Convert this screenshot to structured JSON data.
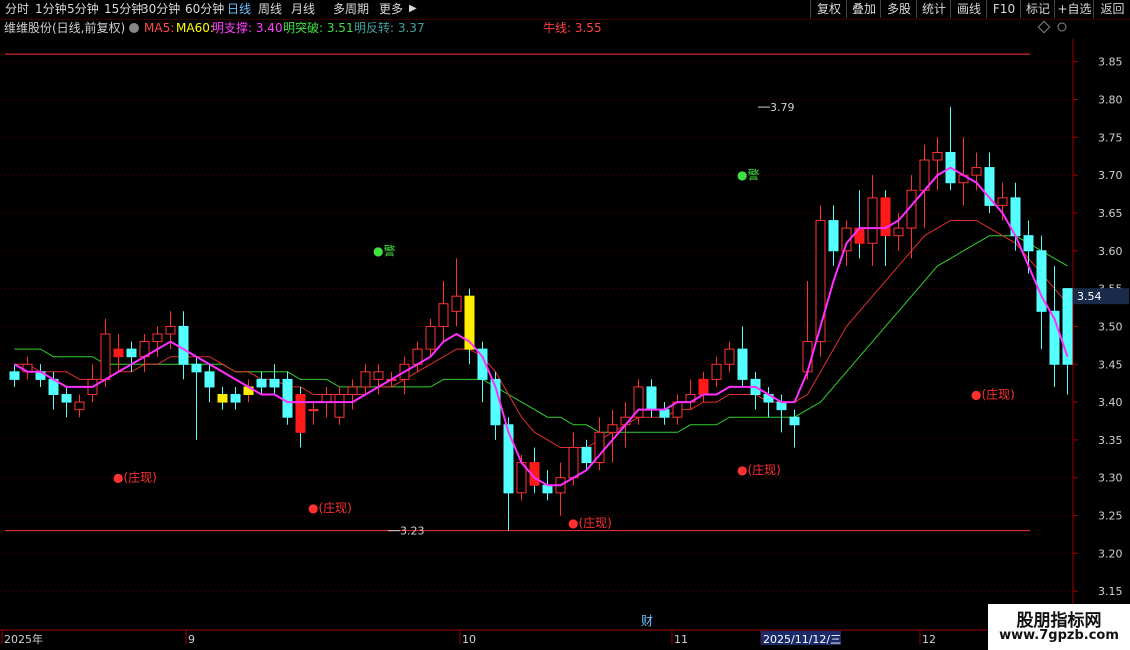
{
  "toolbar": {
    "periods": [
      "分时",
      "1分钟",
      "5分钟",
      "15分钟",
      "30分钟",
      "60分钟",
      "日线",
      "周线",
      "月线",
      "多周期",
      "更多"
    ],
    "active": "日线",
    "right": [
      "复权",
      "叠加",
      "多股",
      "统计",
      "画线",
      "F10",
      "标记",
      "+自选",
      "返回"
    ]
  },
  "indicator_bar": {
    "stock": "维维股份(日线,前复权)",
    "items": [
      {
        "text": "MA5:",
        "color": "#ff4a4a"
      },
      {
        "text": "MA60:",
        "color": "#ffff00"
      },
      {
        "text": "明支撑: 3.40",
        "color": "#ff40ff"
      },
      {
        "text": "明突破: 3.51",
        "color": "#40e040"
      },
      {
        "text": "明反转: 3.37",
        "color": "#40a0a0"
      }
    ],
    "niu_label": "牛线: 3.55"
  },
  "current_price": "3.54",
  "x_axis": {
    "labels": [
      "2025年",
      "9",
      "10",
      "11",
      "2025/11/12/三",
      "12"
    ],
    "cai": "财"
  },
  "watermark": {
    "line1": "股朋指标网",
    "line2": "www.7gpzb.com"
  },
  "colors": {
    "up": "#ff3232",
    "down": "#54ffff",
    "ma_fast": "#ff30ff",
    "ma_mid": "#e03030",
    "ma_slow": "#30d030",
    "grid": "#5a0000"
  },
  "chart_data": {
    "type": "candlestick",
    "y_ticks": [
      "3.85",
      "3.80",
      "3.75",
      "3.70",
      "3.65",
      "3.60",
      "3.55",
      "3.50",
      "3.45",
      "3.40",
      "3.35",
      "3.30",
      "3.25",
      "3.20",
      "3.15"
    ],
    "ylim": [
      3.1,
      3.88
    ],
    "n_bars": 82,
    "ohlc": [
      [
        3.44,
        3.45,
        3.42,
        3.43
      ],
      [
        3.44,
        3.46,
        3.43,
        3.45
      ],
      [
        3.44,
        3.45,
        3.42,
        3.43
      ],
      [
        3.43,
        3.44,
        3.39,
        3.41
      ],
      [
        3.41,
        3.42,
        3.38,
        3.4
      ],
      [
        3.39,
        3.41,
        3.38,
        3.4
      ],
      [
        3.41,
        3.45,
        3.4,
        3.43
      ],
      [
        3.43,
        3.51,
        3.42,
        3.49
      ],
      [
        3.46,
        3.49,
        3.44,
        3.47
      ],
      [
        3.47,
        3.48,
        3.44,
        3.46
      ],
      [
        3.46,
        3.49,
        3.44,
        3.48
      ],
      [
        3.48,
        3.5,
        3.46,
        3.49
      ],
      [
        3.49,
        3.52,
        3.47,
        3.5
      ],
      [
        3.5,
        3.52,
        3.43,
        3.45
      ],
      [
        3.45,
        3.46,
        3.35,
        3.44
      ],
      [
        3.44,
        3.45,
        3.4,
        3.42
      ],
      [
        3.41,
        3.42,
        3.39,
        3.4
      ],
      [
        3.41,
        3.42,
        3.39,
        3.4
      ],
      [
        3.41,
        3.43,
        3.4,
        3.42
      ],
      [
        3.43,
        3.44,
        3.41,
        3.42
      ],
      [
        3.43,
        3.45,
        3.41,
        3.42
      ],
      [
        3.43,
        3.44,
        3.37,
        3.38
      ],
      [
        3.41,
        3.42,
        3.34,
        3.36
      ],
      [
        3.39,
        3.4,
        3.37,
        3.39
      ],
      [
        3.4,
        3.42,
        3.38,
        3.41
      ],
      [
        3.38,
        3.42,
        3.37,
        3.41
      ],
      [
        3.41,
        3.43,
        3.39,
        3.42
      ],
      [
        3.42,
        3.45,
        3.41,
        3.44
      ],
      [
        3.43,
        3.45,
        3.41,
        3.44
      ],
      [
        3.43,
        3.44,
        3.42,
        3.43
      ],
      [
        3.43,
        3.46,
        3.41,
        3.45
      ],
      [
        3.45,
        3.48,
        3.44,
        3.47
      ],
      [
        3.47,
        3.51,
        3.46,
        3.5
      ],
      [
        3.5,
        3.56,
        3.48,
        3.53
      ],
      [
        3.52,
        3.59,
        3.5,
        3.54
      ],
      [
        3.54,
        3.55,
        3.45,
        3.47
      ],
      [
        3.47,
        3.48,
        3.4,
        3.43
      ],
      [
        3.43,
        3.44,
        3.35,
        3.37
      ],
      [
        3.37,
        3.38,
        3.23,
        3.28
      ],
      [
        3.28,
        3.33,
        3.27,
        3.32
      ],
      [
        3.32,
        3.34,
        3.28,
        3.29
      ],
      [
        3.29,
        3.31,
        3.27,
        3.28
      ],
      [
        3.28,
        3.32,
        3.25,
        3.3
      ],
      [
        3.3,
        3.36,
        3.29,
        3.34
      ],
      [
        3.34,
        3.35,
        3.31,
        3.32
      ],
      [
        3.32,
        3.38,
        3.31,
        3.36
      ],
      [
        3.36,
        3.39,
        3.32,
        3.37
      ],
      [
        3.37,
        3.4,
        3.34,
        3.38
      ],
      [
        3.38,
        3.43,
        3.37,
        3.42
      ],
      [
        3.42,
        3.43,
        3.38,
        3.39
      ],
      [
        3.39,
        3.4,
        3.37,
        3.38
      ],
      [
        3.38,
        3.41,
        3.37,
        3.4
      ],
      [
        3.4,
        3.43,
        3.39,
        3.41
      ],
      [
        3.41,
        3.44,
        3.4,
        3.43
      ],
      [
        3.43,
        3.46,
        3.42,
        3.45
      ],
      [
        3.45,
        3.48,
        3.44,
        3.47
      ],
      [
        3.47,
        3.5,
        3.42,
        3.43
      ],
      [
        3.43,
        3.44,
        3.39,
        3.41
      ],
      [
        3.41,
        3.42,
        3.38,
        3.4
      ],
      [
        3.4,
        3.41,
        3.36,
        3.39
      ],
      [
        3.38,
        3.39,
        3.34,
        3.37
      ],
      [
        3.44,
        3.56,
        3.43,
        3.48
      ],
      [
        3.48,
        3.66,
        3.46,
        3.64
      ],
      [
        3.64,
        3.66,
        3.58,
        3.6
      ],
      [
        3.6,
        3.64,
        3.58,
        3.63
      ],
      [
        3.63,
        3.68,
        3.59,
        3.61
      ],
      [
        3.61,
        3.7,
        3.58,
        3.67
      ],
      [
        3.67,
        3.68,
        3.58,
        3.62
      ],
      [
        3.62,
        3.65,
        3.6,
        3.63
      ],
      [
        3.63,
        3.7,
        3.59,
        3.68
      ],
      [
        3.68,
        3.74,
        3.63,
        3.72
      ],
      [
        3.72,
        3.75,
        3.68,
        3.73
      ],
      [
        3.73,
        3.79,
        3.68,
        3.69
      ],
      [
        3.69,
        3.75,
        3.66,
        3.7
      ],
      [
        3.7,
        3.73,
        3.68,
        3.71
      ],
      [
        3.71,
        3.73,
        3.65,
        3.66
      ],
      [
        3.66,
        3.69,
        3.64,
        3.67
      ],
      [
        3.67,
        3.69,
        3.6,
        3.62
      ],
      [
        3.62,
        3.64,
        3.57,
        3.6
      ],
      [
        3.6,
        3.62,
        3.47,
        3.52
      ],
      [
        3.52,
        3.58,
        3.42,
        3.45
      ],
      [
        3.55,
        3.54,
        3.41,
        3.45
      ]
    ],
    "ma_fast": [
      3.45,
      3.44,
      3.44,
      3.43,
      3.42,
      3.42,
      3.42,
      3.43,
      3.44,
      3.45,
      3.46,
      3.47,
      3.48,
      3.47,
      3.46,
      3.45,
      3.44,
      3.43,
      3.42,
      3.41,
      3.41,
      3.4,
      3.4,
      3.4,
      3.4,
      3.4,
      3.4,
      3.41,
      3.42,
      3.43,
      3.44,
      3.45,
      3.46,
      3.48,
      3.49,
      3.48,
      3.46,
      3.42,
      3.36,
      3.32,
      3.3,
      3.29,
      3.29,
      3.3,
      3.31,
      3.33,
      3.35,
      3.37,
      3.39,
      3.39,
      3.39,
      3.4,
      3.4,
      3.41,
      3.41,
      3.42,
      3.42,
      3.42,
      3.41,
      3.4,
      3.4,
      3.44,
      3.5,
      3.56,
      3.61,
      3.63,
      3.63,
      3.63,
      3.64,
      3.66,
      3.68,
      3.7,
      3.71,
      3.7,
      3.69,
      3.67,
      3.65,
      3.62,
      3.58,
      3.54,
      3.51,
      3.46
    ],
    "ma_mid": [
      3.45,
      3.45,
      3.44,
      3.44,
      3.44,
      3.43,
      3.43,
      3.43,
      3.44,
      3.44,
      3.45,
      3.45,
      3.46,
      3.46,
      3.46,
      3.46,
      3.45,
      3.44,
      3.44,
      3.43,
      3.43,
      3.42,
      3.42,
      3.41,
      3.41,
      3.41,
      3.41,
      3.41,
      3.42,
      3.42,
      3.43,
      3.44,
      3.45,
      3.46,
      3.47,
      3.47,
      3.46,
      3.44,
      3.41,
      3.38,
      3.36,
      3.35,
      3.34,
      3.34,
      3.34,
      3.35,
      3.36,
      3.37,
      3.38,
      3.38,
      3.38,
      3.39,
      3.39,
      3.4,
      3.4,
      3.41,
      3.41,
      3.41,
      3.4,
      3.4,
      3.4,
      3.41,
      3.44,
      3.47,
      3.5,
      3.52,
      3.54,
      3.56,
      3.58,
      3.6,
      3.62,
      3.63,
      3.64,
      3.64,
      3.64,
      3.63,
      3.62,
      3.61,
      3.59,
      3.57,
      3.55,
      3.53
    ],
    "ma_slow": [
      3.47,
      3.47,
      3.47,
      3.46,
      3.46,
      3.46,
      3.46,
      3.45,
      3.45,
      3.45,
      3.45,
      3.45,
      3.45,
      3.45,
      3.45,
      3.45,
      3.45,
      3.44,
      3.44,
      3.44,
      3.44,
      3.44,
      3.43,
      3.43,
      3.43,
      3.42,
      3.42,
      3.42,
      3.42,
      3.42,
      3.42,
      3.42,
      3.42,
      3.43,
      3.43,
      3.43,
      3.43,
      3.42,
      3.41,
      3.4,
      3.39,
      3.38,
      3.38,
      3.37,
      3.37,
      3.36,
      3.36,
      3.36,
      3.36,
      3.36,
      3.36,
      3.36,
      3.37,
      3.37,
      3.37,
      3.38,
      3.38,
      3.38,
      3.38,
      3.38,
      3.38,
      3.39,
      3.4,
      3.42,
      3.44,
      3.46,
      3.48,
      3.5,
      3.52,
      3.54,
      3.56,
      3.58,
      3.59,
      3.6,
      3.61,
      3.62,
      3.62,
      3.62,
      3.61,
      3.6,
      3.59,
      3.58
    ],
    "niu_line": 3.55,
    "zhuang_marks": [
      {
        "bar": 7,
        "price": 3.3,
        "label": "●(庄现)"
      },
      {
        "bar": 22,
        "price": 3.26,
        "label": "●(庄现)"
      },
      {
        "bar": 42,
        "price": 3.24,
        "label": "●(庄现)"
      },
      {
        "bar": 55,
        "price": 3.31,
        "label": "●(庄现)"
      },
      {
        "bar": 73,
        "price": 3.41,
        "label": "●(庄现)"
      }
    ],
    "jing_marks": [
      {
        "bar": 27,
        "price": 3.6,
        "label": "●警"
      },
      {
        "bar": 55,
        "price": 3.7,
        "label": "●警"
      }
    ],
    "annotations": [
      {
        "bar": 60,
        "price": 3.79,
        "label": "3.79"
      },
      {
        "bar": 31,
        "price": 3.23,
        "label": "3.23"
      }
    ],
    "resistance": 3.86,
    "support": 3.23,
    "highlight_bars": {
      "red": [
        8,
        22,
        40,
        53,
        65,
        67
      ],
      "yellow": [
        16,
        18,
        35
      ]
    }
  }
}
